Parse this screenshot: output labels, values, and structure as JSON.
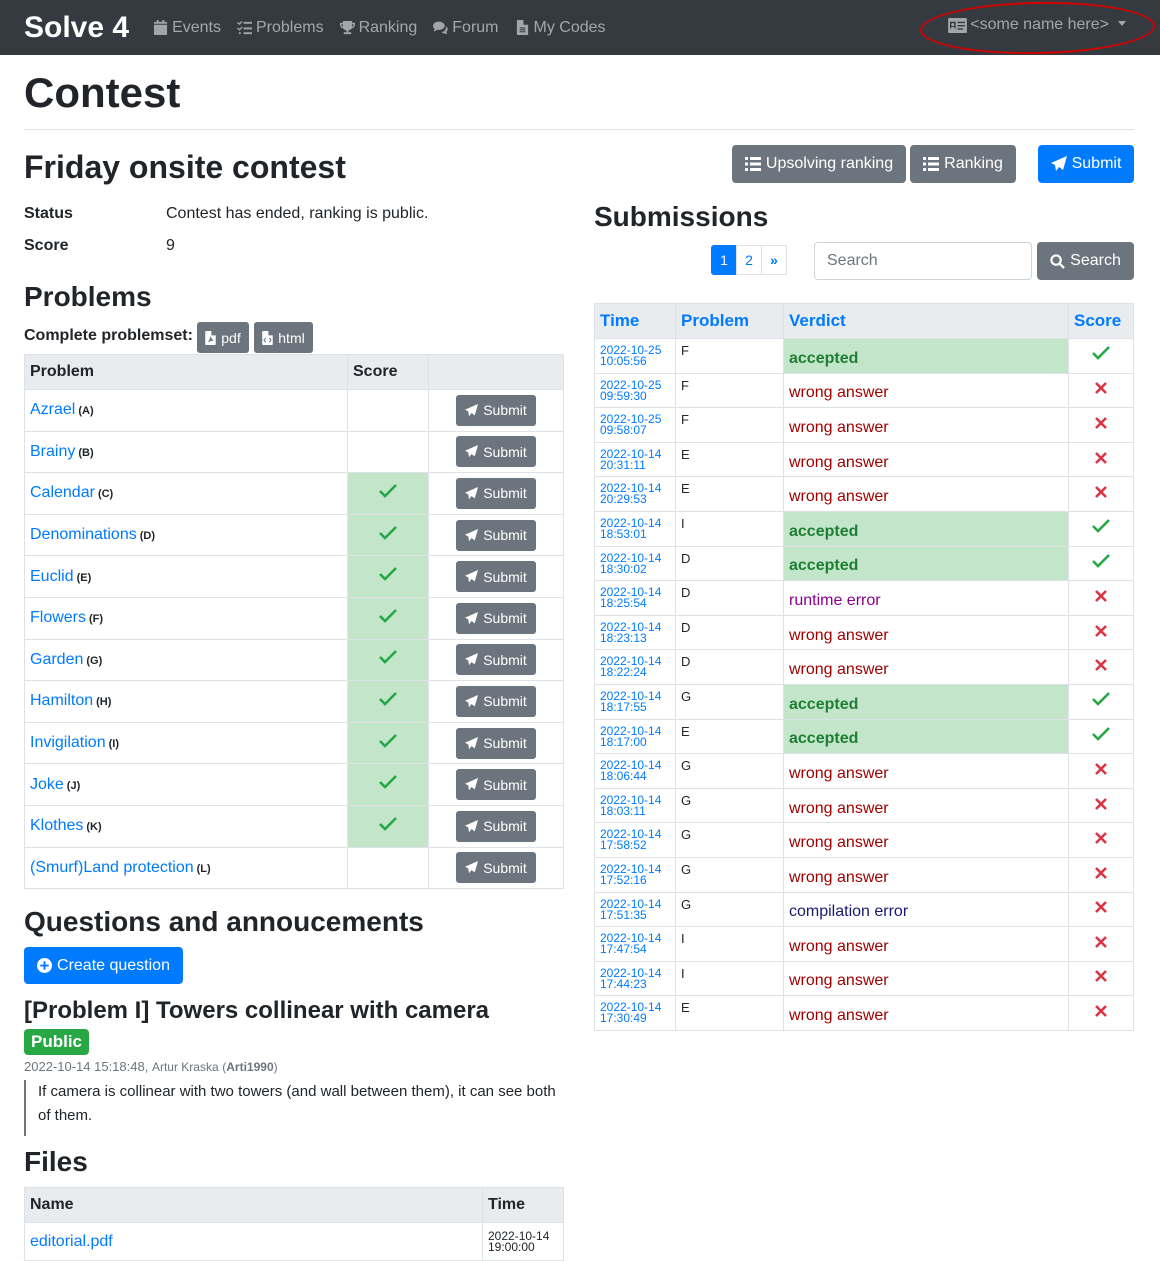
{
  "navbar": {
    "brand": "Solve 4",
    "links": [
      "Events",
      "Problems",
      "Ranking",
      "Forum",
      "My Codes"
    ],
    "user": "<some name here>"
  },
  "page_title": "Contest",
  "contest": {
    "title": "Friday onsite contest",
    "status_label": "Status",
    "status_value": "Contest has ended, ranking is public.",
    "score_label": "Score",
    "score_value": "9",
    "buttons": {
      "upsolving": "Upsolving ranking",
      "ranking": "Ranking",
      "submit": "Submit"
    }
  },
  "problems": {
    "heading": "Problems",
    "problemset_label": "Complete problemset:",
    "pdf": "pdf",
    "html": "html",
    "headers": [
      "Problem",
      "Score",
      ""
    ],
    "submit_label": "Submit",
    "rows": [
      {
        "name": "Azrael",
        "letter": "(A)",
        "solved": false
      },
      {
        "name": "Brainy",
        "letter": "(B)",
        "solved": false
      },
      {
        "name": "Calendar",
        "letter": "(C)",
        "solved": true
      },
      {
        "name": "Denominations",
        "letter": "(D)",
        "solved": true
      },
      {
        "name": "Euclid",
        "letter": "(E)",
        "solved": true
      },
      {
        "name": "Flowers",
        "letter": "(F)",
        "solved": true
      },
      {
        "name": "Garden",
        "letter": "(G)",
        "solved": true
      },
      {
        "name": "Hamilton",
        "letter": "(H)",
        "solved": true
      },
      {
        "name": "Invigilation",
        "letter": "(I)",
        "solved": true
      },
      {
        "name": "Joke",
        "letter": "(J)",
        "solved": true
      },
      {
        "name": "Klothes",
        "letter": "(K)",
        "solved": true
      },
      {
        "name": "(Smurf)Land protection",
        "letter": "(L)",
        "solved": false
      }
    ]
  },
  "questions": {
    "heading": "Questions and annoucements",
    "create_button": "Create question",
    "item": {
      "title": "[Problem I] Towers collinear with camera",
      "badge": "Public",
      "timestamp": "2022-10-14 15:18:48,",
      "author": "Artur Kraska",
      "login": "Arti1990",
      "body": "If camera is collinear with two towers (and wall between them), it can see both of them."
    }
  },
  "files": {
    "heading": "Files",
    "headers": [
      "Name",
      "Time"
    ],
    "rows": [
      {
        "name": "editorial.pdf",
        "date": "2022-10-14",
        "time": "19:00:00"
      }
    ]
  },
  "submissions": {
    "heading": "Submissions",
    "pages": [
      "1",
      "2",
      "»"
    ],
    "search_placeholder": "Search",
    "search_button": "Search",
    "headers": [
      "Time",
      "Problem",
      "Verdict",
      "Score"
    ],
    "rows": [
      {
        "date": "2022-10-25",
        "time": "10:05:56",
        "problem": "F",
        "verdict": "accepted",
        "kind": "accepted"
      },
      {
        "date": "2022-10-25",
        "time": "09:59:30",
        "problem": "F",
        "verdict": "wrong answer",
        "kind": "wrong"
      },
      {
        "date": "2022-10-25",
        "time": "09:58:07",
        "problem": "F",
        "verdict": "wrong answer",
        "kind": "wrong"
      },
      {
        "date": "2022-10-14",
        "time": "20:31:11",
        "problem": "E",
        "verdict": "wrong answer",
        "kind": "wrong"
      },
      {
        "date": "2022-10-14",
        "time": "20:29:53",
        "problem": "E",
        "verdict": "wrong answer",
        "kind": "wrong"
      },
      {
        "date": "2022-10-14",
        "time": "18:53:01",
        "problem": "I",
        "verdict": "accepted",
        "kind": "accepted"
      },
      {
        "date": "2022-10-14",
        "time": "18:30:02",
        "problem": "D",
        "verdict": "accepted",
        "kind": "accepted"
      },
      {
        "date": "2022-10-14",
        "time": "18:25:54",
        "problem": "D",
        "verdict": "runtime error",
        "kind": "runtime"
      },
      {
        "date": "2022-10-14",
        "time": "18:23:13",
        "problem": "D",
        "verdict": "wrong answer",
        "kind": "wrong"
      },
      {
        "date": "2022-10-14",
        "time": "18:22:24",
        "problem": "D",
        "verdict": "wrong answer",
        "kind": "wrong"
      },
      {
        "date": "2022-10-14",
        "time": "18:17:55",
        "problem": "G",
        "verdict": "accepted",
        "kind": "accepted"
      },
      {
        "date": "2022-10-14",
        "time": "18:17:00",
        "problem": "E",
        "verdict": "accepted",
        "kind": "accepted"
      },
      {
        "date": "2022-10-14",
        "time": "18:06:44",
        "problem": "G",
        "verdict": "wrong answer",
        "kind": "wrong"
      },
      {
        "date": "2022-10-14",
        "time": "18:03:11",
        "problem": "G",
        "verdict": "wrong answer",
        "kind": "wrong"
      },
      {
        "date": "2022-10-14",
        "time": "17:58:52",
        "problem": "G",
        "verdict": "wrong answer",
        "kind": "wrong"
      },
      {
        "date": "2022-10-14",
        "time": "17:52:16",
        "problem": "G",
        "verdict": "wrong answer",
        "kind": "wrong"
      },
      {
        "date": "2022-10-14",
        "time": "17:51:35",
        "problem": "G",
        "verdict": "compilation error",
        "kind": "compile"
      },
      {
        "date": "2022-10-14",
        "time": "17:47:54",
        "problem": "I",
        "verdict": "wrong answer",
        "kind": "wrong"
      },
      {
        "date": "2022-10-14",
        "time": "17:44:23",
        "problem": "I",
        "verdict": "wrong answer",
        "kind": "wrong"
      },
      {
        "date": "2022-10-14",
        "time": "17:30:49",
        "problem": "E",
        "verdict": "wrong answer",
        "kind": "wrong"
      }
    ]
  },
  "colors": {
    "navbar": "#343a40",
    "primary": "#007bff",
    "secondary": "#6c757d",
    "success_bg": "#c3e6cb",
    "success": "#28a745",
    "danger": "#dc3545"
  }
}
